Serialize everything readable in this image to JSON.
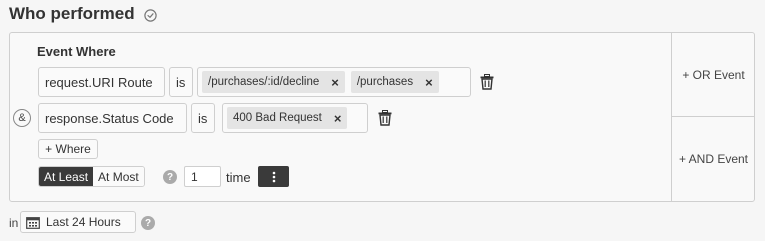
{
  "section": {
    "title": "Who performed",
    "title_icon": "clock-circle-icon"
  },
  "filter": {
    "heading": "Event Where",
    "conditions": [
      {
        "property": "request.URI Route",
        "operator": "is",
        "values": [
          "/purchases/:id/decline",
          "/purchases"
        ]
      },
      {
        "property": "response.Status Code",
        "operator": "is",
        "values": [
          "400 Bad Request"
        ]
      }
    ],
    "conjunction": "&",
    "add_where_label": "+ Where",
    "remove_chip_glyph": "×"
  },
  "frequency": {
    "options": [
      "At Least",
      "At Most"
    ],
    "selected": "At Least",
    "count": "1",
    "unit_label": "time",
    "help_glyph": "?"
  },
  "side_actions": {
    "or_label": "+ OR Event",
    "and_label": "+ AND Event"
  },
  "time_range": {
    "prefix": "in",
    "value": "Last 24 Hours",
    "help_glyph": "?"
  },
  "colors": {
    "background": "#f6f6f6",
    "border": "#cfcfcf",
    "chip": "#e4e4e4",
    "active_segment": "#3a3a3a",
    "help_icon": "#aaaaaa"
  }
}
